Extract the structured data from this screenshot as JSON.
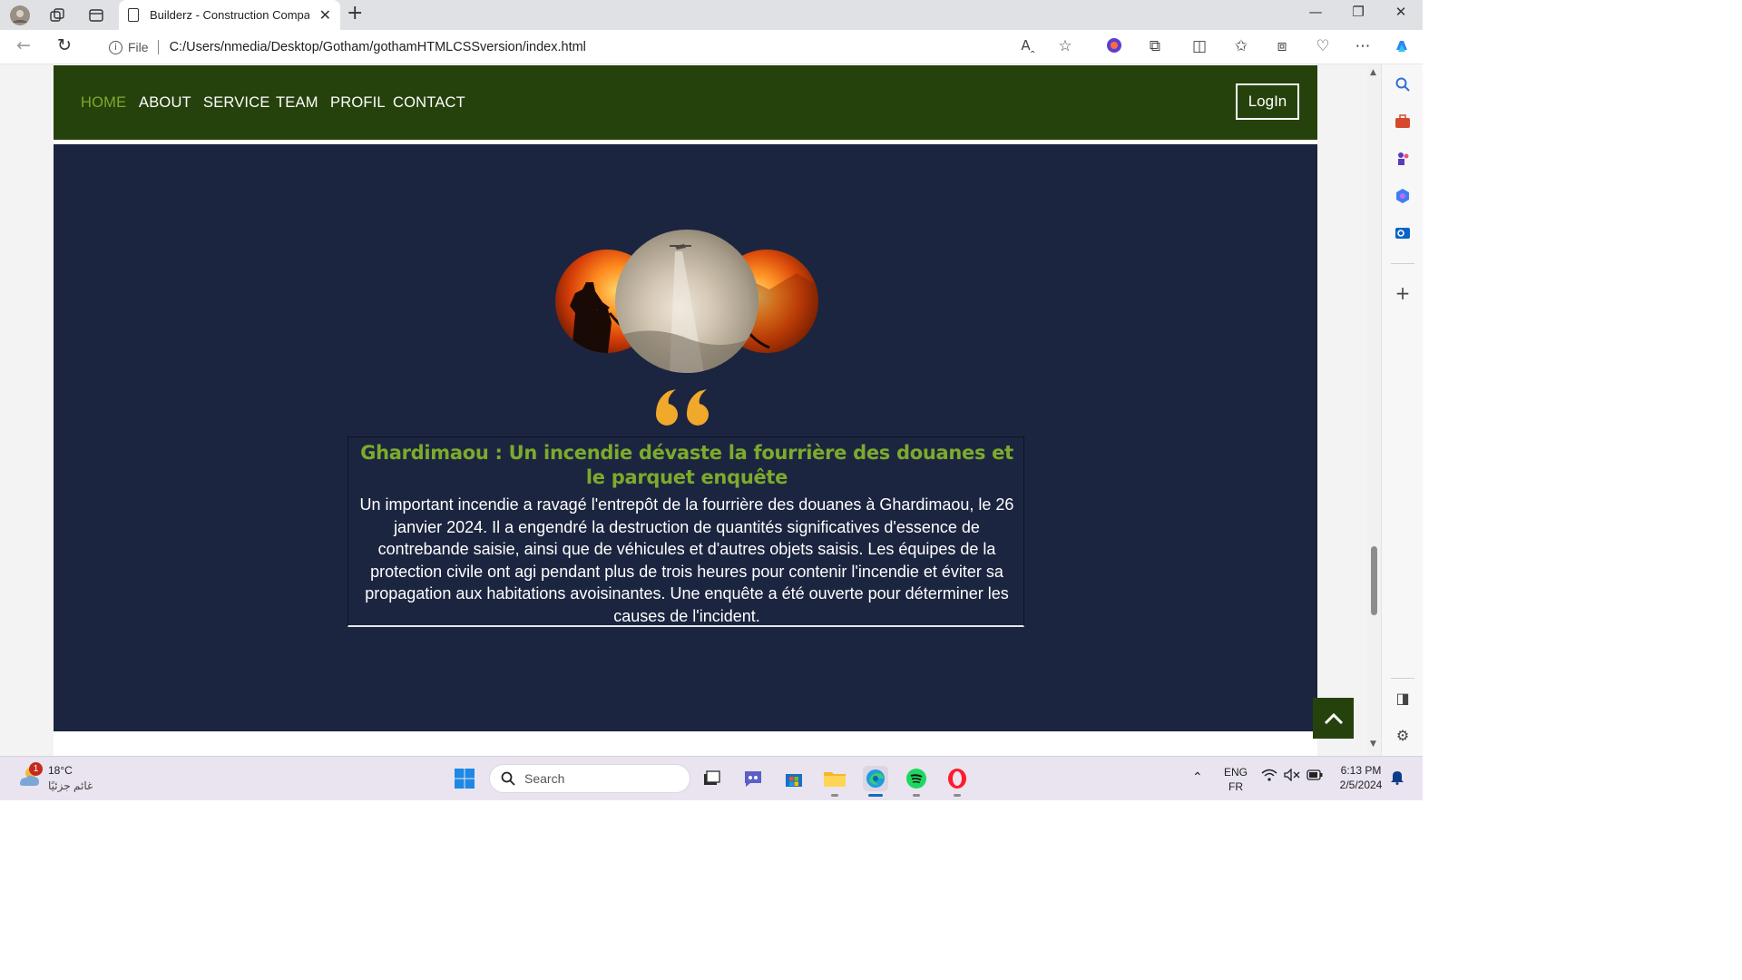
{
  "browser": {
    "tab_title": "Builderz - Construction Company",
    "url_scheme_label": "File",
    "url": "C:/Users/nmedia/Desktop/Gotham/gothamHTMLCSSversion/index.html"
  },
  "site_nav": {
    "links": [
      "HOME",
      "ABOUT",
      "SERVICE",
      "TEAM",
      "PROFIL",
      "CONTACT"
    ],
    "active": "HOME",
    "login_label": "LogIn"
  },
  "article": {
    "title": "Ghardimaou : Un incendie dévaste la fourrière des douanes et le parquet enquête",
    "body": "Un important incendie a ravagé l'entrepôt de la fourrière des douanes à Ghardimaou, le 26 janvier 2024. Il a engendré la destruction de quantités significatives d'essence de contrebande saisie, ainsi que de véhicules et d'autres objets saisis. Les équipes de la protection civile ont agi pendant plus de trois heures pour contenir l'incendie et éviter sa propagation aux habitations avoisinantes. Une enquête a été ouverte pour déterminer les causes de l'incident."
  },
  "taskbar": {
    "weather_temp": "18°C",
    "weather_desc": "غائم جزئيًا",
    "weather_badge": "1",
    "search_placeholder": "Search",
    "lang_primary": "ENG",
    "lang_secondary": "FR",
    "time": "6:13 PM",
    "date": "2/5/2024"
  },
  "colors": {
    "nav_bg": "#26420c",
    "accent_green": "#7cab2b",
    "hero_bg": "#1c2540",
    "quote_gold": "#f0a92a"
  }
}
